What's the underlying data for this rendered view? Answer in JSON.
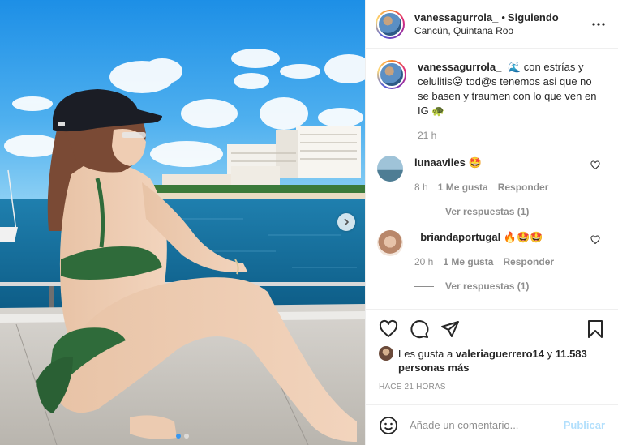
{
  "post": {
    "author": "vanessagurrola_",
    "separator": "•",
    "follow_status": "Siguiendo",
    "location": "Cancún, Quintana Roo"
  },
  "caption": {
    "username": "vanessagurrola_",
    "text_1": "🌊 con estrías y celulitis😛 tod@s tenemos asi que no se basen y traumen con lo que ven en IG 🐢",
    "time": "21 h"
  },
  "comments": [
    {
      "username": "lunaaviles",
      "emoji_text": "🤩",
      "time": "8 h",
      "likes": "1 Me gusta",
      "reply": "Responder",
      "view_replies": "Ver respuestas (1)"
    },
    {
      "username": "_briandaportugal",
      "emoji_text": "🔥🤩🤩",
      "time": "20 h",
      "likes": "1 Me gusta",
      "reply": "Responder",
      "view_replies": "Ver respuestas (1)"
    }
  ],
  "likes": {
    "prefix": "Les gusta a",
    "user": "valeriaguerrero14",
    "connector": "y",
    "count": "11.583 personas más"
  },
  "posted_ago": "HACE 21 HORAS",
  "add_comment": {
    "placeholder": "Añade un comentario...",
    "publish": "Publicar"
  },
  "icons": {
    "more": "more-options-icon",
    "next": "chevron-right-icon",
    "like": "heart-icon",
    "comment": "comment-bubble-icon",
    "share": "paper-plane-icon",
    "save": "bookmark-icon",
    "emoji": "smiley-icon"
  },
  "colors": {
    "accent": "#3897f0",
    "publish_disabled": "#b2dffc",
    "muted": "#8e8e8e"
  }
}
